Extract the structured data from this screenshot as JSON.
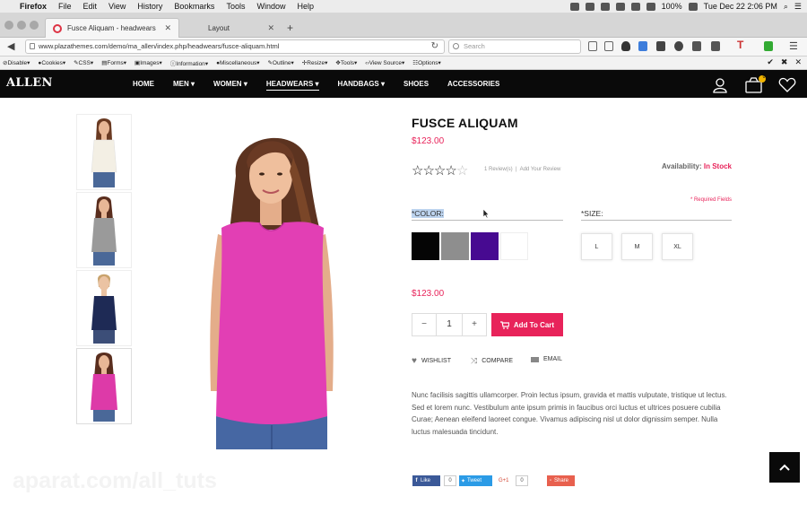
{
  "menubar": {
    "app_name": "Firefox",
    "items": [
      "File",
      "Edit",
      "View",
      "History",
      "Bookmarks",
      "Tools",
      "Window",
      "Help"
    ],
    "battery": "100%",
    "clock": "Tue Dec 22  2:06 PM"
  },
  "tabs": [
    {
      "title": "Fusce Aliquam - headwears",
      "active": true
    },
    {
      "title": "Layout",
      "active": false
    }
  ],
  "navbar": {
    "url": "www.plazathemes.com/demo/ma_allen/index.php/headwears/fusce-aliquam.html",
    "search_placeholder": "Search"
  },
  "devbar": {
    "items": [
      "Disable",
      "Cookies",
      "CSS",
      "Forms",
      "Images",
      "Information",
      "Miscellaneous",
      "Outline",
      "Resize",
      "Tools",
      "View Source",
      "Options"
    ]
  },
  "site": {
    "logo": "ALLEN",
    "nav": [
      {
        "label": "HOME",
        "dropdown": false,
        "active": false
      },
      {
        "label": "MEN",
        "dropdown": true,
        "active": false
      },
      {
        "label": "WOMEN",
        "dropdown": true,
        "active": false
      },
      {
        "label": "HEADWEARS",
        "dropdown": true,
        "active": true
      },
      {
        "label": "HANDBAGS",
        "dropdown": true,
        "active": false
      },
      {
        "label": "SHOES",
        "dropdown": false,
        "active": false
      },
      {
        "label": "ACCESSORIES",
        "dropdown": false,
        "active": false
      }
    ],
    "cart_count": "0"
  },
  "product": {
    "title": "FUSCE ALIQUAM",
    "price": "$123.00",
    "price_repeat": "$123.00",
    "rating": 3.5,
    "rating_max": 5,
    "reviews_text": "1 Review(s)",
    "add_review": "Add Your Review",
    "availability_label": "Availability:",
    "availability_value": "In Stock",
    "required_note": "* Required Fields",
    "color_label": "*COLOR:",
    "size_label": "*SIZE:",
    "swatches": [
      "#050505",
      "#8e8e8e",
      "#470a91",
      "#ffffff"
    ],
    "sizes": [
      "L",
      "M",
      "XL"
    ],
    "qty_minus": "−",
    "qty": "1",
    "qty_plus": "+",
    "add_to_cart": "Add To Cart",
    "actions": [
      "WISHLIST",
      "COMPARE",
      "EMAIL"
    ],
    "description": "Nunc facilisis sagittis ullamcorper. Proin lectus ipsum, gravida et mattis vulputate, tristique ut lectus. Sed et lorem nunc. Vestibulum ante ipsum primis in faucibus orci luctus et ultrices posuere cubilia Curae; Aenean eleifend laoreet congue. Vivamus adipiscing nisl ut dolor dignissim semper. Nulla luctus malesuada tincidunt.",
    "share": {
      "like": "Like",
      "like_count": "0",
      "tweet": "Tweet",
      "tweet_count": "0",
      "gplus": "G+1",
      "gplus_count": "0",
      "share": "Share"
    },
    "thumb_colors": [
      "#f3efe4",
      "#9a9a9a",
      "#1e2a55",
      "#dd3aa8"
    ],
    "main_color": "#e23fb4"
  },
  "watermark": "aparat.com/all_tuts"
}
